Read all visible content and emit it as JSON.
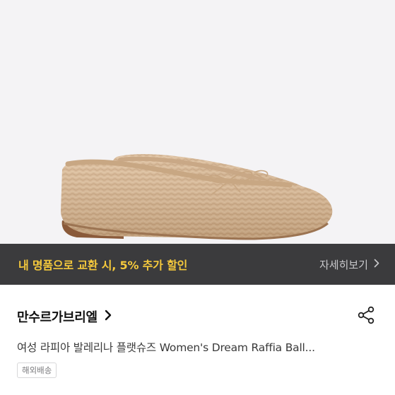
{
  "product": {
    "image_alt": "raffia ballet flat shoes",
    "brand": "만수르가브리엘",
    "title": "여성 라피아 발레리나 플랫슈즈 Women's Dream Raffia Ball...",
    "shipping_badge": "해외배송"
  },
  "promo": {
    "text": "내 명품으로 교환 시, 5% 추가 할인",
    "detail_label": "자세히보기"
  },
  "icons": {
    "promo_chevron": "chevron-right-icon",
    "brand_chevron": "chevron-right-icon",
    "share": "share-icon"
  },
  "colors": {
    "promo_background": "#3b3b3d",
    "promo_text": "#f5c93c",
    "image_background": "#f4f3f5"
  }
}
